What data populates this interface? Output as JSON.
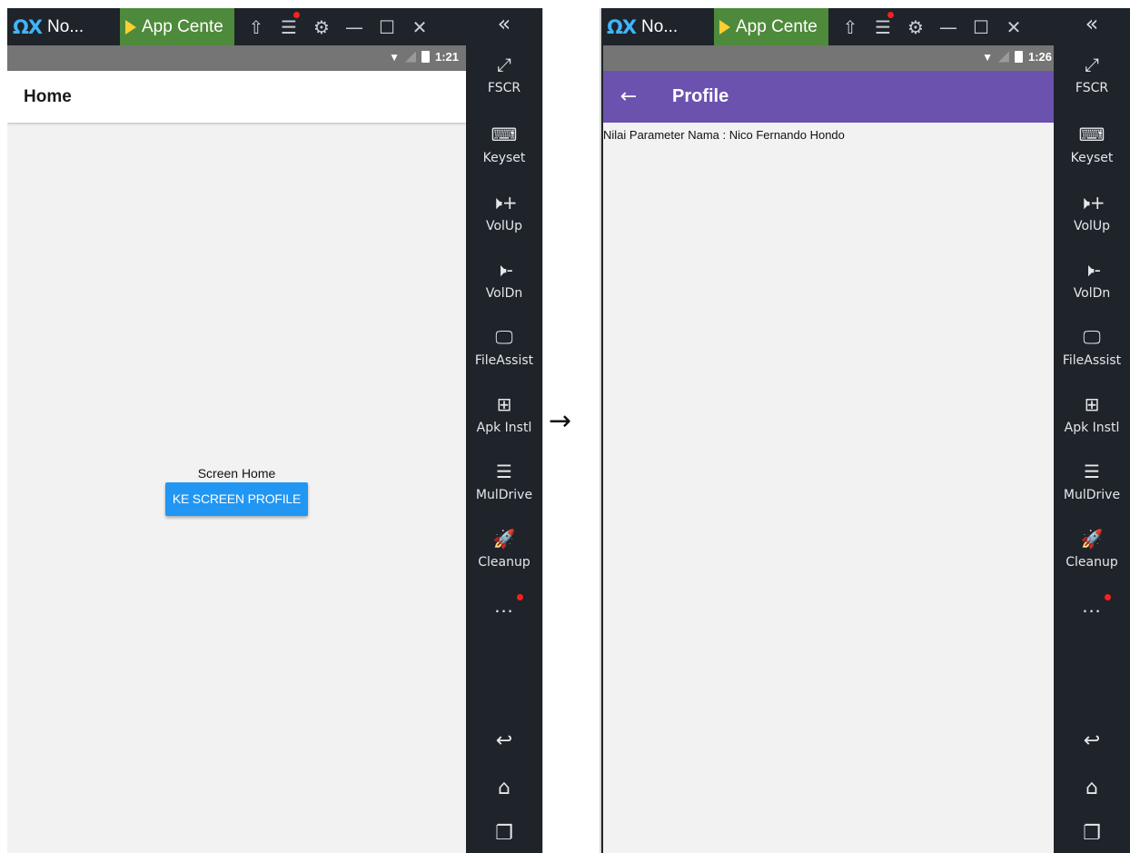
{
  "arrow": "→",
  "emulators": [
    {
      "window": {
        "logo": "ΩX",
        "title": "No...",
        "app_center": "App Cente",
        "icons": [
          "shirt-icon",
          "menu-icon",
          "gear-icon",
          "minimize-icon",
          "maximize-icon",
          "close-icon"
        ]
      },
      "status": {
        "time": "1:21"
      },
      "screen": {
        "appbar_title": "Home",
        "center_text": "Screen Home",
        "button_label": "KE SCREEN PROFILE"
      }
    },
    {
      "window": {
        "logo": "ΩX",
        "title": "No...",
        "app_center": "App Cente",
        "icons": [
          "shirt-icon",
          "menu-icon",
          "gear-icon",
          "minimize-icon",
          "maximize-icon",
          "close-icon"
        ]
      },
      "status": {
        "time": "1:26"
      },
      "screen": {
        "appbar_title": "Profile",
        "param_text": "Nilai Parameter Nama : Nico Fernando Hondo"
      }
    }
  ],
  "sidebar": {
    "items": [
      {
        "label": "FSCR",
        "icon": "fullscreen-icon",
        "glyph": "⤢"
      },
      {
        "label": "Keyset",
        "icon": "keyboard-icon",
        "glyph": "⌨"
      },
      {
        "label": "VolUp",
        "icon": "volume-up-icon",
        "glyph": "🕨+"
      },
      {
        "label": "VolDn",
        "icon": "volume-down-icon",
        "glyph": "🕨-"
      },
      {
        "label": "FileAssist",
        "icon": "monitor-icon",
        "glyph": "🖵"
      },
      {
        "label": "Apk Instl",
        "icon": "apk-install-icon",
        "glyph": "⊞"
      },
      {
        "label": "MulDrive",
        "icon": "multi-drive-icon",
        "glyph": "☰"
      },
      {
        "label": "Cleanup",
        "icon": "rocket-icon",
        "glyph": "🚀"
      }
    ],
    "more": "...",
    "nav": [
      {
        "icon": "back-icon",
        "glyph": "↩"
      },
      {
        "icon": "home-icon",
        "glyph": "⌂"
      },
      {
        "icon": "recents-icon",
        "glyph": "❐"
      }
    ]
  },
  "colors": {
    "emulator_bg": "#1f232a",
    "nox_blue": "#3fb5ff",
    "app_center_green": "#4e8a3b",
    "profile_appbar": "#6b52ae",
    "button_blue": "#2196f3",
    "status_gray": "#757575",
    "notification_red": "#ff1e1e"
  }
}
